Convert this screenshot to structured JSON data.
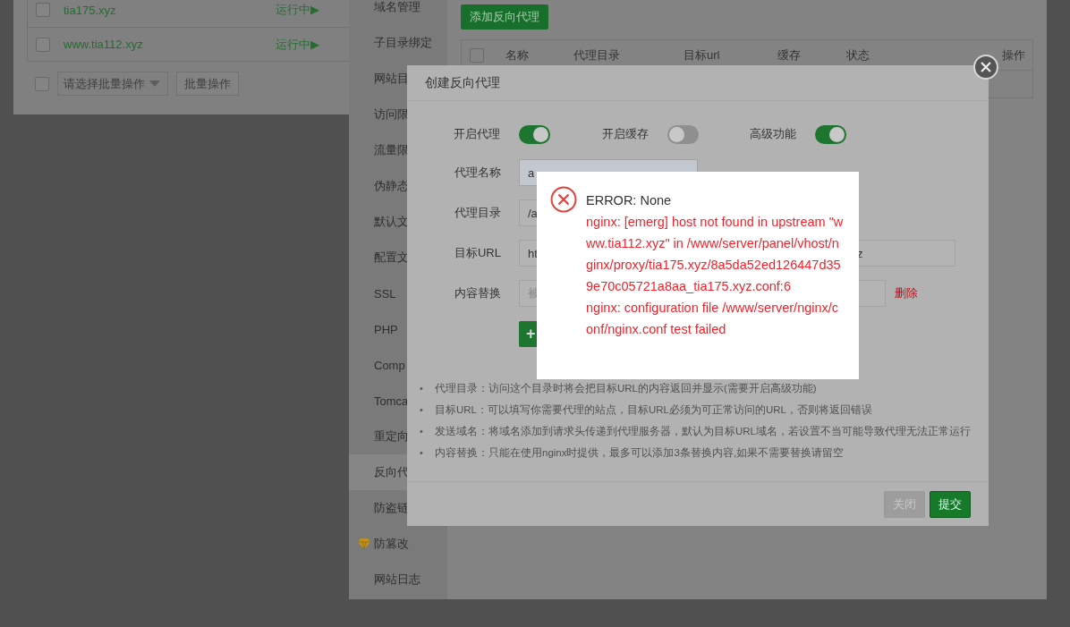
{
  "site_list": {
    "rows": [
      {
        "name": "tia175.xyz",
        "status": "运行中▶",
        "checked": false
      },
      {
        "name": "www.tia112.xyz",
        "status": "运行中▶",
        "checked": false
      }
    ],
    "batch": {
      "checked": false,
      "select_placeholder": "请选择批量操作",
      "button": "批量操作"
    }
  },
  "side_panel": {
    "menu": [
      {
        "label": "域名管理",
        "selected": false,
        "kind": "plain"
      },
      {
        "label": "子目录绑定",
        "selected": false,
        "kind": "plain"
      },
      {
        "label": "网站目",
        "selected": false,
        "kind": "plain"
      },
      {
        "label": "访问限",
        "selected": false,
        "kind": "plain"
      },
      {
        "label": "流量限",
        "selected": false,
        "kind": "plain"
      },
      {
        "label": "伪静态",
        "selected": false,
        "kind": "plain"
      },
      {
        "label": "默认文",
        "selected": false,
        "kind": "plain"
      },
      {
        "label": "配置文",
        "selected": false,
        "kind": "plain"
      },
      {
        "label": "SSL",
        "selected": false,
        "kind": "plain"
      },
      {
        "label": "PHP",
        "selected": false,
        "kind": "plain"
      },
      {
        "label": "Comp",
        "selected": false,
        "kind": "plain"
      },
      {
        "label": "Tomca",
        "selected": false,
        "kind": "plain"
      },
      {
        "label": "重定向",
        "selected": false,
        "kind": "plain"
      },
      {
        "label": "反向代",
        "selected": true,
        "kind": "plain"
      },
      {
        "label": "防盗链",
        "selected": false,
        "kind": "plain"
      },
      {
        "label": "防篡改",
        "selected": false,
        "kind": "premium"
      },
      {
        "label": "网站日志",
        "selected": false,
        "kind": "plain"
      }
    ],
    "add_button": "添加反向代理",
    "table": {
      "checked": false,
      "columns": [
        "名称",
        "代理目录",
        "目标url",
        "缓存",
        "状态",
        "操作"
      ]
    }
  },
  "dialog": {
    "title": "创建反向代理",
    "toggles": [
      {
        "label": "开启代理",
        "on": true
      },
      {
        "label": "开启缓存",
        "on": false
      },
      {
        "label": "高级功能",
        "on": true
      }
    ],
    "form": [
      {
        "label": "代理名称",
        "value": "a",
        "kind": "single"
      },
      {
        "label": "代理目录",
        "value": "/a",
        "kind": "single"
      },
      {
        "label": "目标URL",
        "value": "ht",
        "kind": "pair",
        "second_value": "z"
      },
      {
        "label": "内容替换",
        "placeholder": "被",
        "kind": "replace",
        "delete_link": "删除"
      }
    ],
    "add_button": "+",
    "tips": [
      {
        "bullet": "•",
        "text": "代理目录：访问这个目录时将会把目标URL的内容返回并显示(需要开启高级功能)"
      },
      {
        "bullet": "•",
        "text": "目标URL：可以填写你需要代理的站点，目标URL必须为可正常访问的URL，否则将返回错误"
      },
      {
        "bullet": "•",
        "text": "发送域名：将域名添加到请求头传递到代理服务器，默认为目标URL域名，若设置不当可能导致代理无法正常运行"
      },
      {
        "bullet": "•",
        "text": "内容替换：只能在使用nginx时提供，最多可以添加3条替换内容,如果不需要替换请留空"
      }
    ],
    "buttons": [
      {
        "label": "关闭",
        "kind": "secondary"
      },
      {
        "label": "提交",
        "kind": "primary"
      }
    ]
  },
  "error": {
    "title": "ERROR: None",
    "messages": [
      "nginx: [emerg] host not found in upstream \"www.tia112.xyz\" in /www/server/panel/vhost/nginx/proxy/tia175.xyz/8a5da52ed126447d359e70c05721a8aa_tia175.xyz.conf:6",
      "nginx: configuration file /www/server/nginx/conf/nginx.conf test failed"
    ]
  }
}
